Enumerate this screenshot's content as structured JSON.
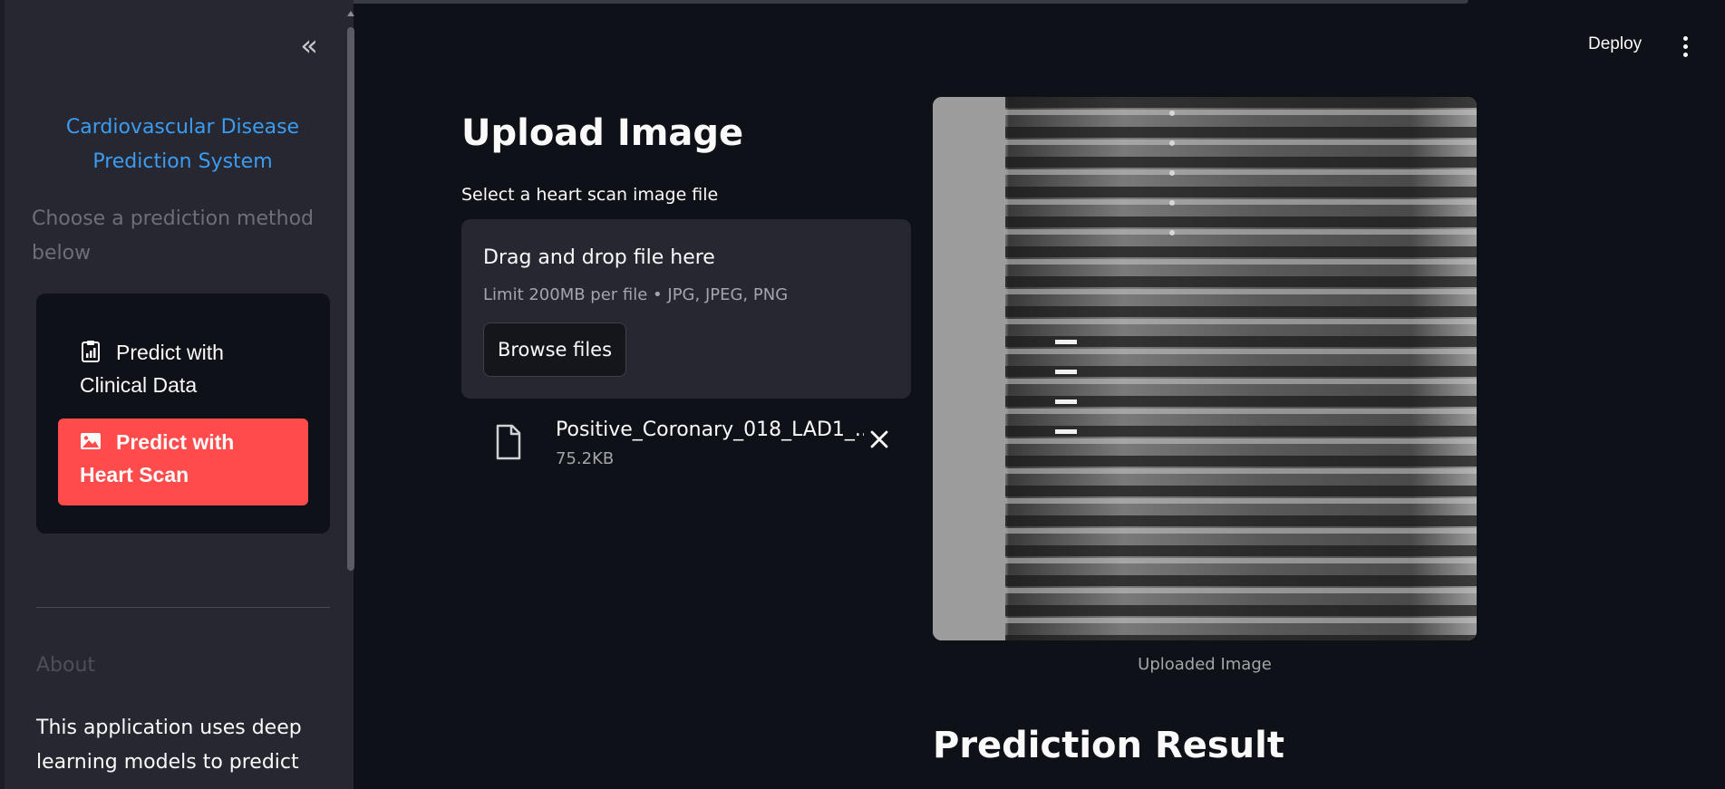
{
  "sidebar": {
    "collapse_glyph": "«",
    "title": "Cardiovascular Disease Prediction System",
    "subtitle": "Choose a prediction method below",
    "menu": [
      {
        "label": "Predict with Clinical Data",
        "icon": "clipboard-chart-icon",
        "selected": false
      },
      {
        "label": "Predict with Heart Scan",
        "icon": "image-icon",
        "selected": true
      }
    ],
    "about_heading": "About",
    "about_text": "This application uses deep learning models to predict"
  },
  "header": {
    "deploy_label": "Deploy",
    "menu_icon": "kebab-menu-icon"
  },
  "main": {
    "upload_title": "Upload Image",
    "upload_label": "Select a heart scan image file",
    "dropzone": {
      "title": "Drag and drop file here",
      "limit": "Limit 200MB per file • JPG, JPEG, PNG",
      "browse_label": "Browse files"
    },
    "file": {
      "name": "Positive_Coronary_018_LAD1_...",
      "size": "75.2KB",
      "icon": "file-icon"
    },
    "image_caption": "Uploaded Image",
    "result_title": "Prediction Result"
  },
  "colors": {
    "background": "#0e1117",
    "sidebar": "#262730",
    "accent": "#ff4b4b",
    "link": "#3b9cf1"
  }
}
